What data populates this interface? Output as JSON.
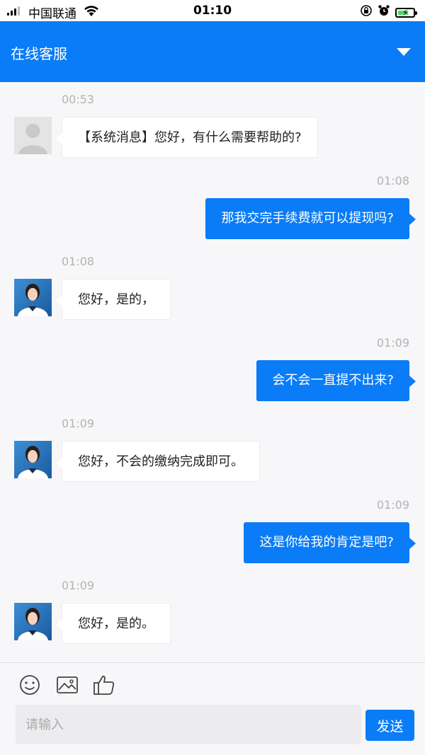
{
  "status_bar": {
    "carrier": "中国联通",
    "time": "01:10"
  },
  "header": {
    "title": "在线客服"
  },
  "messages": [
    {
      "from": "system",
      "time": "00:53",
      "text": "【系统消息】您好，有什么需要帮助的?"
    },
    {
      "from": "user",
      "time": "01:08",
      "text": "那我交完手续费就可以提现吗?"
    },
    {
      "from": "agent",
      "time": "01:08",
      "text": "您好，是的，"
    },
    {
      "from": "user",
      "time": "01:09",
      "text": "会不会一直提不出来?"
    },
    {
      "from": "agent",
      "time": "01:09",
      "text": "您好，不会的缴纳完成即可。"
    },
    {
      "from": "user",
      "time": "01:09",
      "text": "这是你给我的肯定是吧?"
    },
    {
      "from": "agent",
      "time": "01:09",
      "text": "您好，是的。"
    }
  ],
  "input": {
    "placeholder": "请输入",
    "send_label": "发送"
  },
  "icons": {
    "toolbar": [
      "emoji-icon",
      "image-icon",
      "thumbs-up-icon"
    ]
  },
  "colors": {
    "accent": "#0a7cf7"
  }
}
